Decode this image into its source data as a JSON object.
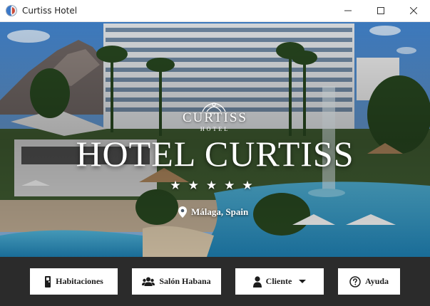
{
  "window": {
    "title": "Curtiss Hotel",
    "icons": {
      "app": "app-logo-icon",
      "minimize": "minimize-icon",
      "maximize": "maximize-icon",
      "close": "close-icon"
    }
  },
  "hero": {
    "brand_name": "CURTISS",
    "brand_sub": "HOTEL",
    "title": "HOTEL CURTISS",
    "stars": "★★★★★",
    "star_rating": 5,
    "location": "Málaga, Spain",
    "location_icon": "map-pin-icon"
  },
  "nav": {
    "rooms": {
      "label": "Habitaciones",
      "icon": "door-icon"
    },
    "salon": {
      "label": "Salón Habana",
      "icon": "users-icon"
    },
    "client": {
      "label": "Cliente",
      "icon": "user-icon",
      "dropdown_icon": "caret-down-icon"
    },
    "help": {
      "label": "Ayuda",
      "icon": "help-circle-icon"
    }
  },
  "colors": {
    "bottom_bar": "#2b2b2b",
    "button_bg": "#ffffff",
    "pool": "#3fa0c8",
    "sky": "#4f86c6"
  }
}
